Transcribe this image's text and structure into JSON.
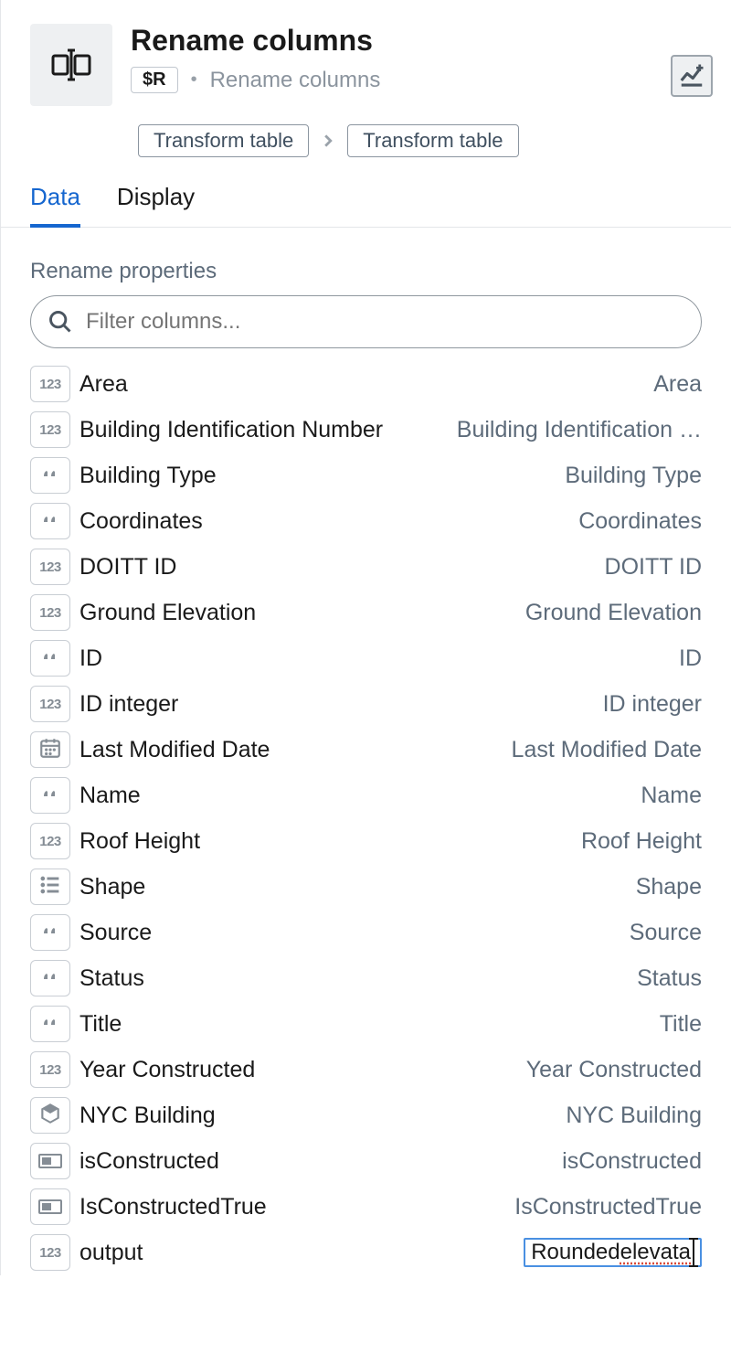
{
  "header": {
    "title": "Rename columns",
    "r_badge": "$R",
    "subtitle": "Rename columns"
  },
  "breadcrumbs": [
    "Transform table",
    "Transform table"
  ],
  "tabs": {
    "data": "Data",
    "display": "Display"
  },
  "section_label": "Rename properties",
  "filter": {
    "placeholder": "Filter columns..."
  },
  "rows": [
    {
      "type": "number",
      "name": "Area",
      "target": "Area",
      "editing": false
    },
    {
      "type": "number",
      "name": "Building Identification Number",
      "target": "Building Identification …",
      "editing": false
    },
    {
      "type": "string",
      "name": "Building Type",
      "target": "Building Type",
      "editing": false
    },
    {
      "type": "string",
      "name": "Coordinates",
      "target": "Coordinates",
      "editing": false
    },
    {
      "type": "number",
      "name": "DOITT ID",
      "target": "DOITT ID",
      "editing": false
    },
    {
      "type": "number",
      "name": "Ground Elevation",
      "target": "Ground Elevation",
      "editing": false
    },
    {
      "type": "string",
      "name": "ID",
      "target": "ID",
      "editing": false
    },
    {
      "type": "number",
      "name": "ID integer",
      "target": "ID integer",
      "editing": false
    },
    {
      "type": "date",
      "name": "Last Modified Date",
      "target": "Last Modified Date",
      "editing": false
    },
    {
      "type": "string",
      "name": "Name",
      "target": "Name",
      "editing": false
    },
    {
      "type": "number",
      "name": "Roof Height",
      "target": "Roof Height",
      "editing": false
    },
    {
      "type": "list",
      "name": "Shape",
      "target": "Shape",
      "editing": false
    },
    {
      "type": "string",
      "name": "Source",
      "target": "Source",
      "editing": false
    },
    {
      "type": "string",
      "name": "Status",
      "target": "Status",
      "editing": false
    },
    {
      "type": "string",
      "name": "Title",
      "target": "Title",
      "editing": false
    },
    {
      "type": "number",
      "name": "Year Constructed",
      "target": "Year Constructed",
      "editing": false
    },
    {
      "type": "object",
      "name": "NYC Building",
      "target": "NYC Building",
      "editing": false
    },
    {
      "type": "boolean",
      "name": "isConstructed",
      "target": "isConstructed",
      "editing": false
    },
    {
      "type": "boolean",
      "name": "IsConstructedTrue",
      "target": "IsConstructedTrue",
      "editing": false
    },
    {
      "type": "number",
      "name": "output",
      "target": "Rounded elevata",
      "editing": true,
      "typed_part": "elevata"
    }
  ]
}
